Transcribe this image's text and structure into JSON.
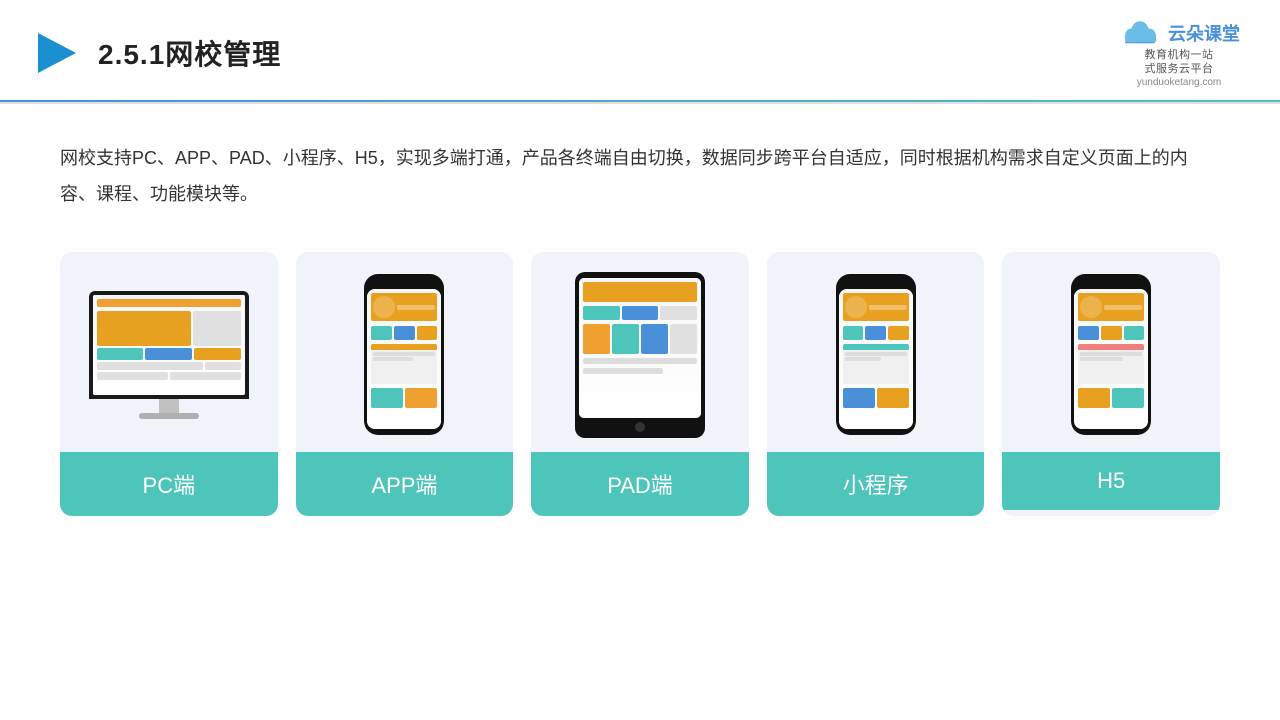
{
  "header": {
    "title": "2.5.1网校管理",
    "title_prefix": "2.5.1",
    "title_main": "网校管理",
    "logo_name": "云朵课堂",
    "logo_url": "yunduoketang.com",
    "logo_tagline": "教育机构一站\n式服务云平台"
  },
  "description": "网校支持PC、APP、PAD、小程序、H5，实现多端打通，产品各终端自由切换，数据同步跨平台自适应，同时根据机构需求自定义页面上的内容、课程、功能模块等。",
  "cards": [
    {
      "id": "pc",
      "label": "PC端"
    },
    {
      "id": "app",
      "label": "APP端"
    },
    {
      "id": "pad",
      "label": "PAD端"
    },
    {
      "id": "miniprogram",
      "label": "小程序"
    },
    {
      "id": "h5",
      "label": "H5"
    }
  ]
}
